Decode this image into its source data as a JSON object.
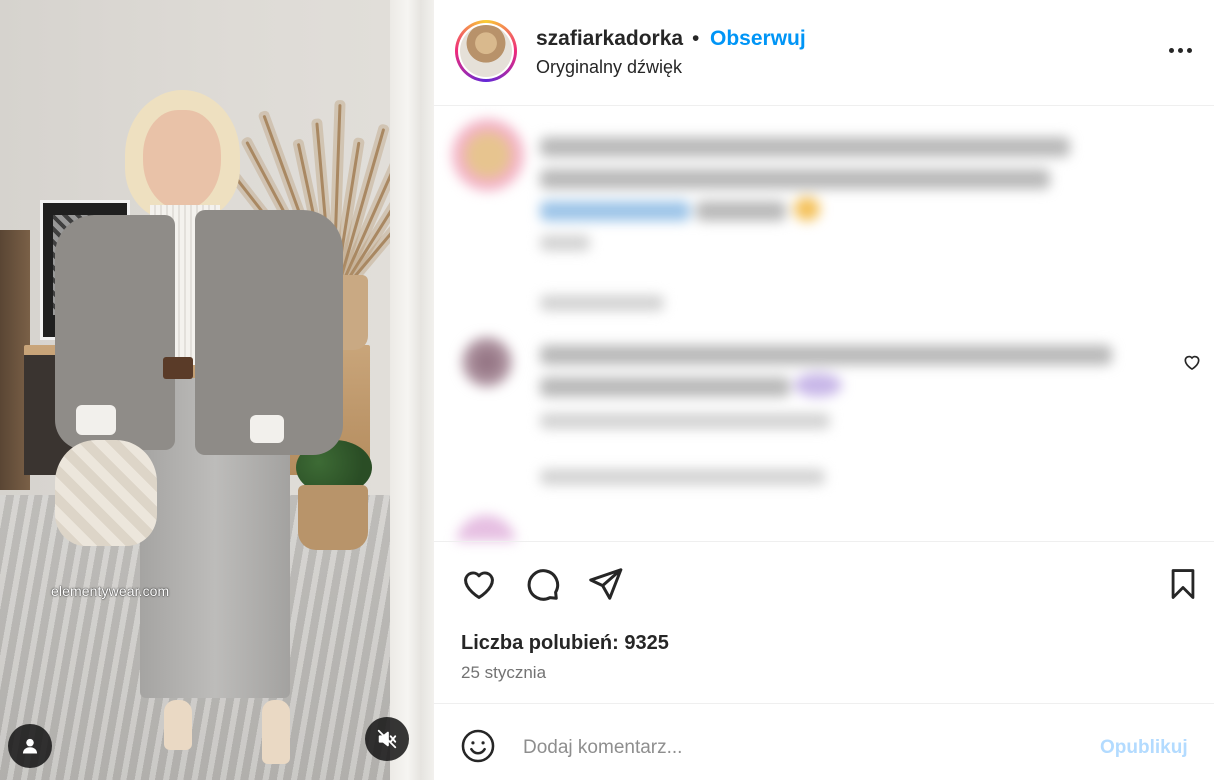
{
  "post": {
    "media": {
      "watermark": "elementywear.com",
      "user_tag_icon": "person-icon",
      "mute_icon": "speaker-muted-icon"
    },
    "header": {
      "username": "szafiarkadorka",
      "separator": "•",
      "follow_label": "Obserwuj",
      "audio_label": "Oryginalny dźwięk",
      "more_icon": "more-horizontal-icon"
    },
    "actions": {
      "like_icon": "heart-icon",
      "comment_icon": "comment-bubble-icon",
      "share_icon": "paper-plane-icon",
      "save_icon": "bookmark-icon"
    },
    "likes_text": "Liczba polubień: 9325",
    "date_text": "25 stycznia",
    "add_comment": {
      "placeholder": "Dodaj komentarz...",
      "publish_label": "Opublikuj",
      "emoji_icon": "smiley-icon"
    },
    "colors": {
      "link_blue": "#0095f6",
      "publish_disabled": "#b3dbff",
      "text_primary": "#262626",
      "text_secondary": "#737373"
    }
  }
}
